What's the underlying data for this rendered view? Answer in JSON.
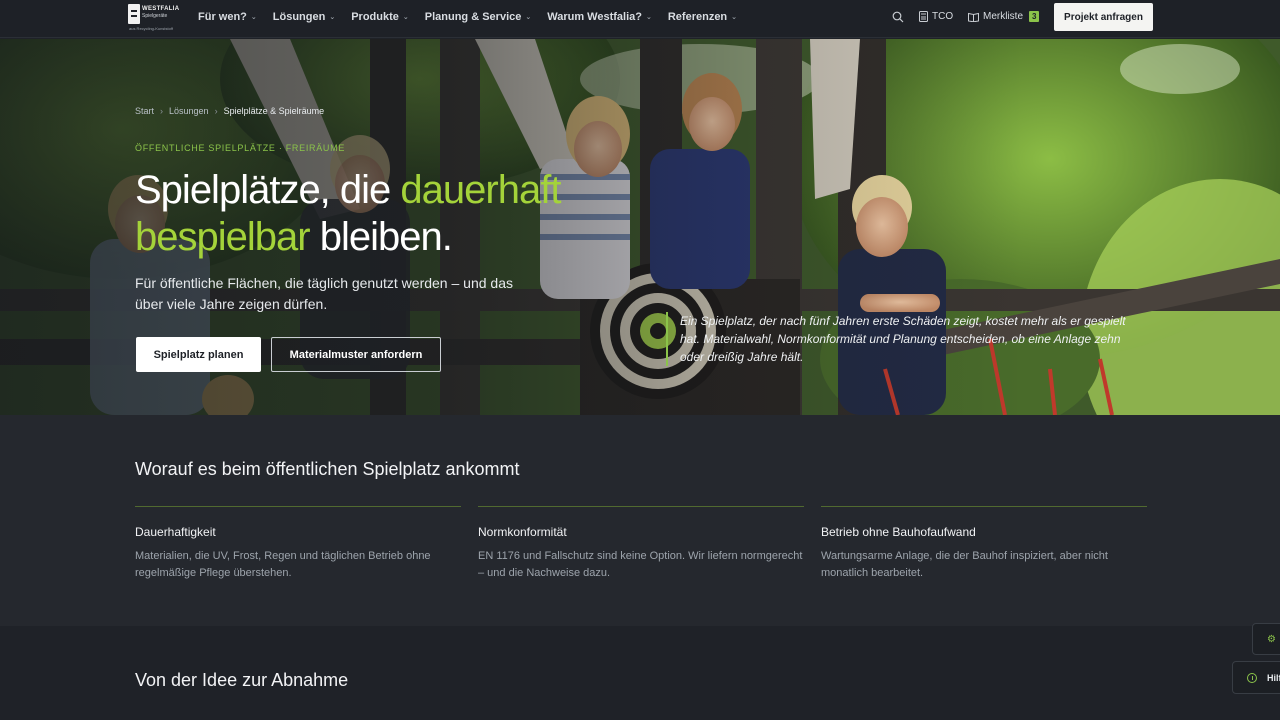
{
  "logo": {
    "line1": "WESTFALIA",
    "line2": "Spielgeräte",
    "line3": "aus Recycling-Kunststoff"
  },
  "nav": {
    "items": [
      {
        "label": "Für wen?"
      },
      {
        "label": "Lösungen"
      },
      {
        "label": "Produkte"
      },
      {
        "label": "Planung & Service"
      },
      {
        "label": "Warum Westfalia?"
      },
      {
        "label": "Referenzen"
      }
    ],
    "tco_label": "TCO",
    "merkliste_label": "Merkliste",
    "merkliste_count": "3",
    "cta_label": "Projekt anfragen"
  },
  "hero": {
    "breadcrumb": [
      "Start",
      "Lösungen",
      "Spielplätze & Spielräume"
    ],
    "eyebrow": "ÖFFENTLICHE SPIELPLÄTZE · FREIRÄUME",
    "title_part1": "Spielplätze, die ",
    "title_accent1": "dauerhaft",
    "title_accent2": "bespielbar",
    "title_part2": " bleiben.",
    "lead": "Für öffentliche Flächen, die täglich genutzt werden – und das über viele Jahre zeigen dürfen.",
    "btn_primary": "Spielplatz planen",
    "btn_secondary": "Materialmuster anfordern",
    "quote": "Ein Spielplatz, der nach fünf Jahren erste Schäden zeigt, kostet mehr als er gespielt hat. Materialwahl, Normkonformität und Planung entscheiden, ob eine Anlage zehn oder dreißig Jahre hält."
  },
  "section2": {
    "title": "Worauf es beim öffentlichen Spielplatz ankommt",
    "columns": [
      {
        "title": "Dauerhaftigkeit",
        "text": "Materialien, die UV, Frost, Regen und täglichen Betrieb ohne regelmäßige Pflege überstehen."
      },
      {
        "title": "Normkonformität",
        "text": "EN 1176 und Fallschutz sind keine Option. Wir liefern normgerecht – und die Nachweise dazu."
      },
      {
        "title": "Betrieb ohne Bauhofaufwand",
        "text": "Wartungsarme Anlage, die der Bauhof inspiziert, aber nicht monatlich bearbeitet."
      }
    ]
  },
  "section3": {
    "title": "Von der Idee zur Abnahme"
  },
  "floating": {
    "help_label": "Hilf"
  },
  "colors": {
    "accent": "#8bc34a",
    "accent_text": "#a4d33a",
    "background": "#1f2228"
  }
}
